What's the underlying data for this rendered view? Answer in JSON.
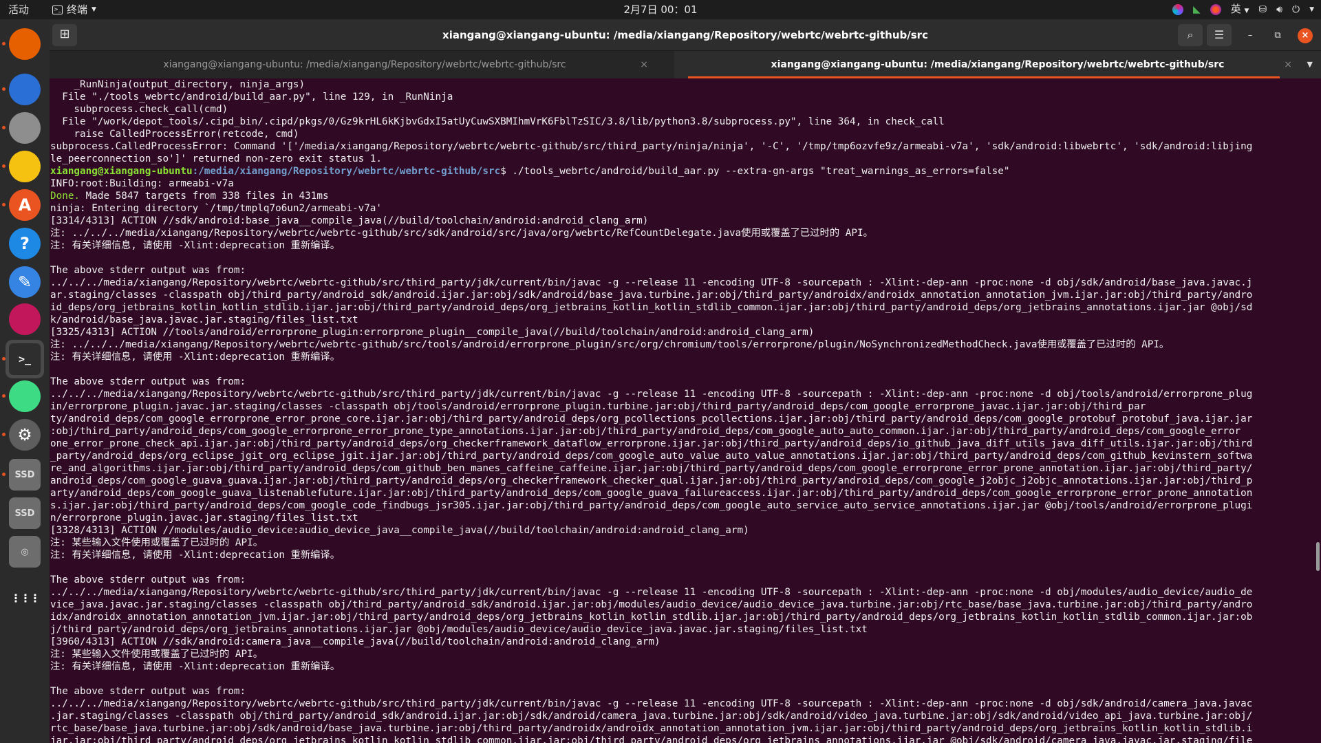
{
  "topbar": {
    "activities": "活动",
    "app_name": "终端",
    "clock": "2月7日  00：01",
    "input_method": "英"
  },
  "window": {
    "title": "xiangang@xiangang-ubuntu: /media/xiangang/Repository/webrtc/webrtc-github/src",
    "tabs": [
      {
        "label": "xiangang@xiangang-ubuntu: /media/xiangang/Repository/webrtc/webrtc-github/src",
        "active": false
      },
      {
        "label": "xiangang@xiangang-ubuntu: /media/xiangang/Repository/webrtc/webrtc-github/src",
        "active": true
      }
    ]
  },
  "dock": {
    "items": [
      {
        "name": "firefox-icon",
        "glyph": "",
        "color": "#e66000"
      },
      {
        "name": "thunderbird-icon",
        "glyph": "",
        "color": "#2a6fd6"
      },
      {
        "name": "files-icon",
        "glyph": "",
        "color": "#8e8e8e"
      },
      {
        "name": "rhythmbox-icon",
        "glyph": "",
        "color": "#f5c211"
      },
      {
        "name": "app-center-icon",
        "glyph": "A",
        "color": "#e95420"
      },
      {
        "name": "help-icon",
        "glyph": "?",
        "color": "#1e88e5"
      },
      {
        "name": "text-editor-icon",
        "glyph": "✎",
        "color": "#3584e4"
      },
      {
        "name": "android-studio-icon",
        "glyph": "",
        "color": "#c2185b"
      },
      {
        "name": "terminal-icon",
        "glyph": ">_",
        "color": "#2e2e2e"
      },
      {
        "name": "android-studio-app-icon",
        "glyph": "",
        "color": "#3ddc84"
      },
      {
        "name": "settings-icon",
        "glyph": "⚙",
        "color": "#5e5e5e"
      },
      {
        "name": "ssd-drive-icon",
        "glyph": "SSD",
        "color": "#6d6d6d"
      },
      {
        "name": "ssd-drive-2-icon",
        "glyph": "SSD",
        "color": "#6d6d6d"
      },
      {
        "name": "optical-drive-icon",
        "glyph": "◎",
        "color": "#6d6d6d"
      },
      {
        "name": "show-apps-icon",
        "glyph": "⋮⋮⋮",
        "color": "#2b2b2b"
      }
    ]
  },
  "terminal": {
    "prompt_user": "xiangang@xiangang-ubuntu",
    "prompt_path": ":/media/xiangang/Repository/webrtc/webrtc-github/src",
    "command": "$ ./tools_webrtc/android/build_aar.py --extra-gn-args \"treat_warnings_as_errors=false\"",
    "lines": [
      "    _RunNinja(output_directory, ninja_args)",
      "  File \"./tools_webrtc/android/build_aar.py\", line 129, in _RunNinja",
      "    subprocess.check_call(cmd)",
      "  File \"/work/depot_tools/.cipd_bin/.cipd/pkgs/0/Gz9krHL6kKjbvGdxI5atUyCuwSXBMIhmVrK6FblTzSIC/3.8/lib/python3.8/subprocess.py\", line 364, in check_call",
      "    raise CalledProcessError(retcode, cmd)",
      "subprocess.CalledProcessError: Command '['/media/xiangang/Repository/webrtc/webrtc-github/src/third_party/ninja/ninja', '-C', '/tmp/tmp6ozvfe9z/armeabi-v7a', 'sdk/android:libwebrtc', 'sdk/android:libjing",
      "le_peerconnection_so']' returned non-zero exit status 1.",
      "",
      "INFO:root:Building: armeabi-v7a",
      "",
      "ninja: Entering directory `/tmp/tmplq7o6un2/armeabi-v7a'",
      "[3314/4313] ACTION //sdk/android:base_java__compile_java(//build/toolchain/android:android_clang_arm)",
      "注: ../../../media/xiangang/Repository/webrtc/webrtc-github/src/sdk/android/src/java/org/webrtc/RefCountDelegate.java使用或覆盖了已过时的 API。",
      "注: 有关详细信息, 请使用 -Xlint:deprecation 重新编译。",
      "",
      "The above stderr output was from:",
      "../../../media/xiangang/Repository/webrtc/webrtc-github/src/third_party/jdk/current/bin/javac -g --release 11 -encoding UTF-8 -sourcepath : -Xlint:-dep-ann -proc:none -d obj/sdk/android/base_java.javac.j",
      "ar.staging/classes -classpath obj/third_party/android_sdk/android.ijar.jar:obj/sdk/android/base_java.turbine.jar:obj/third_party/androidx/androidx_annotation_annotation_jvm.ijar.jar:obj/third_party/andro",
      "id_deps/org_jetbrains_kotlin_kotlin_stdlib.ijar.jar:obj/third_party/android_deps/org_jetbrains_kotlin_kotlin_stdlib_common.ijar.jar:obj/third_party/android_deps/org_jetbrains_annotations.ijar.jar @obj/sd",
      "k/android/base_java.javac.jar.staging/files_list.txt",
      "[3325/4313] ACTION //tools/android/errorprone_plugin:errorprone_plugin__compile_java(//build/toolchain/android:android_clang_arm)",
      "注: ../../../media/xiangang/Repository/webrtc/webrtc-github/src/tools/android/errorprone_plugin/src/org/chromium/tools/errorprone/plugin/NoSynchronizedMethodCheck.java使用或覆盖了已过时的 API。",
      "注: 有关详细信息, 请使用 -Xlint:deprecation 重新编译。",
      "",
      "The above stderr output was from:",
      "../../../media/xiangang/Repository/webrtc/webrtc-github/src/third_party/jdk/current/bin/javac -g --release 11 -encoding UTF-8 -sourcepath : -Xlint:-dep-ann -proc:none -d obj/tools/android/errorprone_plug",
      "in/errorprone_plugin.javac.jar.staging/classes -classpath obj/tools/android/errorprone_plugin.turbine.jar:obj/third_party/android_deps/com_google_errorprone_javac.ijar.jar:obj/third_par",
      "ty/android_deps/com_google_errorprone_error_prone_core.ijar.jar:obj/third_party/android_deps/org_pcollections_pcollections.ijar.jar:obj/third_party/android_deps/com_google_protobuf_protobuf_java.ijar.jar",
      ":obj/third_party/android_deps/com_google_errorprone_error_prone_type_annotations.ijar.jar:obj/third_party/android_deps/com_google_auto_auto_common.ijar.jar:obj/third_party/android_deps/com_google_error",
      "one_error_prone_check_api.ijar.jar:obj/third_party/android_deps/org_checkerframework_dataflow_errorprone.ijar.jar:obj/third_party/android_deps/io_github_java_diff_utils_java_diff_utils.ijar.jar:obj/third",
      "_party/android_deps/org_eclipse_jgit_org_eclipse_jgit.ijar.jar:obj/third_party/android_deps/com_google_auto_value_auto_value_annotations.ijar.jar:obj/third_party/android_deps/com_github_kevinstern_softwa",
      "re_and_algorithms.ijar.jar:obj/third_party/android_deps/com_github_ben_manes_caffeine_caffeine.ijar.jar:obj/third_party/android_deps/com_google_errorprone_error_prone_annotation.ijar.jar:obj/third_party/",
      "android_deps/com_google_guava_guava.ijar.jar:obj/third_party/android_deps/org_checkerframework_checker_qual.ijar.jar:obj/third_party/android_deps/com_google_j2objc_j2objc_annotations.ijar.jar:obj/third_p",
      "arty/android_deps/com_google_guava_listenablefuture.ijar.jar:obj/third_party/android_deps/com_google_guava_failureaccess.ijar.jar:obj/third_party/android_deps/com_google_errorprone_error_prone_annotation",
      "s.ijar.jar:obj/third_party/android_deps/com_google_code_findbugs_jsr305.ijar.jar:obj/third_party/android_deps/com_google_auto_service_auto_service_annotations.ijar.jar @obj/tools/android/errorprone_plugi",
      "n/errorprone_plugin.javac.jar.staging/files_list.txt",
      "[3328/4313] ACTION //modules/audio_device:audio_device_java__compile_java(//build/toolchain/android:android_clang_arm)",
      "注: 某些输入文件使用或覆盖了已过时的 API。",
      "注: 有关详细信息, 请使用 -Xlint:deprecation 重新编译。",
      "",
      "The above stderr output was from:",
      "../../../media/xiangang/Repository/webrtc/webrtc-github/src/third_party/jdk/current/bin/javac -g --release 11 -encoding UTF-8 -sourcepath : -Xlint:-dep-ann -proc:none -d obj/modules/audio_device/audio_de",
      "vice_java.javac.jar.staging/classes -classpath obj/third_party/android_sdk/android.ijar.jar:obj/modules/audio_device/audio_device_java.turbine.jar:obj/rtc_base/base_java.turbine.jar:obj/third_party/andro",
      "idx/androidx_annotation_annotation_jvm.ijar.jar:obj/third_party/android_deps/org_jetbrains_kotlin_kotlin_stdlib.ijar.jar:obj/third_party/android_deps/org_jetbrains_kotlin_kotlin_stdlib_common.ijar.jar:ob",
      "j/third_party/android_deps/org_jetbrains_annotations.ijar.jar @obj/modules/audio_device/audio_device_java.javac.jar.staging/files_list.txt",
      "[3960/4313] ACTION //sdk/android:camera_java__compile_java(//build/toolchain/android:android_clang_arm)",
      "注: 某些输入文件使用或覆盖了已过时的 API。",
      "注: 有关详细信息, 请使用 -Xlint:deprecation 重新编译。",
      "",
      "The above stderr output was from:",
      "../../../media/xiangang/Repository/webrtc/webrtc-github/src/third_party/jdk/current/bin/javac -g --release 11 -encoding UTF-8 -sourcepath : -Xlint:-dep-ann -proc:none -d obj/sdk/android/camera_java.javac",
      ".jar.staging/classes -classpath obj/third_party/android_sdk/android.ijar.jar:obj/sdk/android/camera_java.turbine.jar:obj/sdk/android/video_java.turbine.jar:obj/sdk/android/video_api_java.turbine.jar:obj/",
      "rtc_base/base_java.turbine.jar:obj/sdk/android/base_java.turbine.jar:obj/third_party/androidx/androidx_annotation_annotation_jvm.ijar.jar:obj/third_party/android_deps/org_jetbrains_kotlin_kotlin_stdlib.i",
      "jar.jar:obj/third_party/android_deps/org_jetbrains_kotlin_kotlin_stdlib_common.ijar.jar:obj/third_party/android_deps/org_jetbrains_annotations.ijar.jar @obj/sdk/android/camera_java.javac.jar.staging/file"
    ],
    "done_label": "Done.",
    "done_rest": " Made 5847 targets from 338 files in 431ms"
  }
}
